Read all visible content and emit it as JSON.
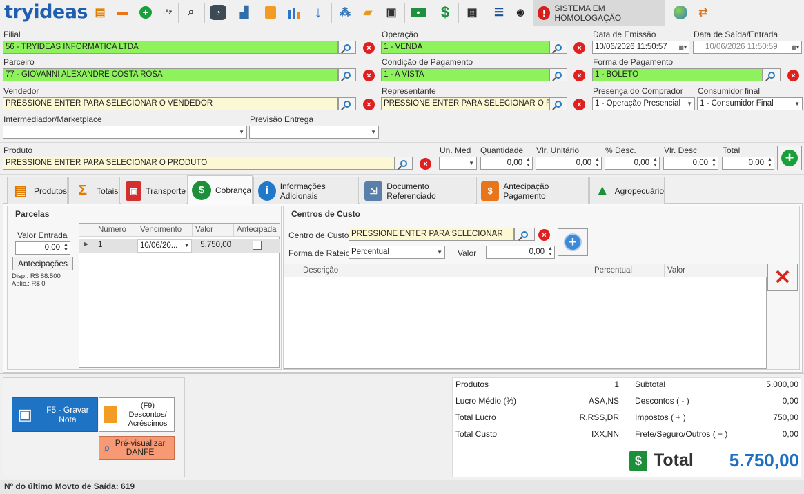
{
  "toolbar": {
    "logo": "tryideas",
    "icons": [
      "boxes-icon",
      "truck-icon",
      "add-icon",
      "sort-icon",
      "search-person-icon",
      "scale-icon",
      "cash-register-icon",
      "shopping-bag-icon",
      "bar-chart-icon",
      "download-arrow-icon",
      "share-nodes-icon",
      "folder-open-icon",
      "save-icon",
      "money-icon",
      "dollar-icon",
      "report-icon",
      "list-icon",
      "eye-icon"
    ],
    "homologation_label": "SISTEMA EM HOMOLOGAÇÃO"
  },
  "header": {
    "filial": {
      "label": "Filial",
      "value": "56 - TRYIDEAS INFORMATICA LTDA"
    },
    "operacao": {
      "label": "Operação",
      "value": "1 - VENDA"
    },
    "data_emissao": {
      "label": "Data de Emissão",
      "value": "10/06/2026 11:50:57"
    },
    "data_saida": {
      "label": "Data de Saída/Entrada",
      "value": "10/06/2026 11:50:59",
      "checked": false
    },
    "parceiro": {
      "label": "Parceiro",
      "value": "77 - GIOVANNI ALEXANDRE COSTA ROSA"
    },
    "condicao": {
      "label": "Condição de Pagamento",
      "value": "1 - A VISTA"
    },
    "forma_pagamento": {
      "label": "Forma de Pagamento",
      "value": "1 - BOLETO"
    },
    "vendedor": {
      "label": "Vendedor",
      "value": "PRESSIONE ENTER PARA SELECIONAR O VENDEDOR"
    },
    "representante": {
      "label": "Representante",
      "value": "PRESSIONE ENTER PARA SELECIONAR O REPRES"
    },
    "presenca": {
      "label": "Presença do Comprador",
      "value": "1 - Operação Presencial"
    },
    "consumidor": {
      "label": "Consumidor final",
      "value": "1 - Consumidor Final"
    },
    "intermediador": {
      "label": "Intermediador/Marketplace",
      "value": ""
    },
    "previsao": {
      "label": "Previsão Entrega",
      "value": ""
    }
  },
  "produto": {
    "label": "Produto",
    "value": "PRESSIONE ENTER PARA SELECIONAR O PRODUTO",
    "un_med_label": "Un. Med",
    "quantidade_label": "Quantidade",
    "quantidade": "0,00",
    "vlr_unitario_label": "Vlr. Unitário",
    "vlr_unitario": "0,00",
    "desc_pct_label": "% Desc.",
    "desc_pct": "0,00",
    "vlr_desc_label": "Vlr. Desc",
    "vlr_desc": "0,00",
    "total_label": "Total",
    "total": "0,00"
  },
  "tabs": [
    {
      "label": "Produtos",
      "icon": "boxes-icon"
    },
    {
      "label": "Totais",
      "icon": "sigma-icon"
    },
    {
      "label": "Transporte",
      "icon": "bus-icon"
    },
    {
      "label": "Cobrança",
      "icon": "dollar-icon",
      "active": true
    },
    {
      "label": "Informações Adicionais",
      "icon": "info-icon"
    },
    {
      "label": "Documento Referenciado",
      "icon": "document-icon"
    },
    {
      "label": "Antecipação Pagamento",
      "icon": "advance-payment-icon"
    },
    {
      "label": "Agropecuário",
      "icon": "tree-icon"
    }
  ],
  "parcelas": {
    "title": "Parcelas",
    "valor_entrada_label": "Valor Entrada",
    "valor_entrada": "0,00",
    "antecipacoes_button": "Antecipações",
    "disp": "Disp.: R$ 88.500",
    "aplic": "Aplic.: R$ 0",
    "columns": [
      "Número",
      "Vencimento",
      "Valor",
      "Antecipada"
    ],
    "rows": [
      {
        "numero": "1",
        "vencimento": "10/06/20...",
        "valor": "5.750,00",
        "antecipada": false
      }
    ]
  },
  "centros": {
    "title": "Centros de Custo",
    "centro_label": "Centro de Custo",
    "centro_value": "PRESSIONE ENTER PARA SELECIONAR",
    "rateio_label": "Forma de Rateio",
    "rateio_value": "Percentual",
    "valor_label": "Valor",
    "valor_value": "0,00",
    "columns": [
      "Descrição",
      "Percentual",
      "Valor"
    ]
  },
  "actions": {
    "gravar": "F5 - Gravar Nota",
    "descontos_key": "(F9)",
    "descontos": "Descontos/ Acréscimos",
    "previsualizar": "Pré-visualizar DANFE"
  },
  "summary": {
    "produtos_label": "Produtos",
    "produtos": "1",
    "lucro_medio_label": "Lucro Médio (%)",
    "lucro_medio": "ASA,NS",
    "total_lucro_label": "Total Lucro",
    "total_lucro": "R.RSS,DR",
    "total_custo_label": "Total Custo",
    "total_custo": "IXX,NN",
    "subtotal_label": "Subtotal",
    "subtotal": "5.000,00",
    "descontos_label": "Descontos ( - )",
    "descontos": "0,00",
    "impostos_label": "Impostos ( + )",
    "impostos": "750,00",
    "frete_label": "Frete/Seguro/Outros ( + )",
    "frete": "0,00",
    "total_label": "Total",
    "total": "5.750,00"
  },
  "status": {
    "text": "Nº do último Movto de Saída: 619"
  },
  "colors": {
    "green_field": "#8ef25c",
    "yellow_field": "#fdf8d4",
    "brand_blue": "#1f5fb0",
    "save_blue": "#1e73c4",
    "preview_orange": "#f79a74"
  }
}
